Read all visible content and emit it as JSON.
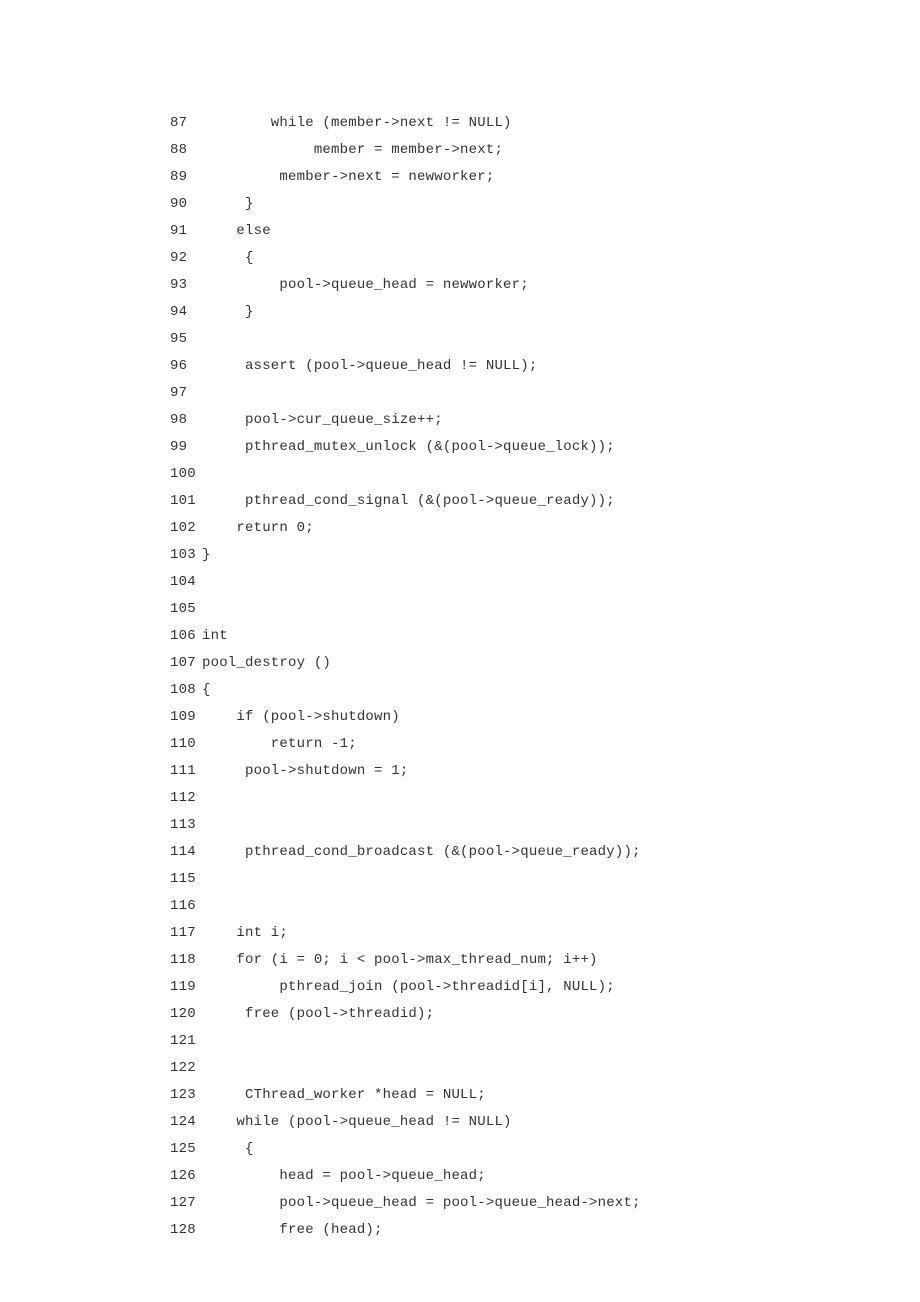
{
  "code_lines": [
    {
      "num": "87",
      "code": "        while (member->next != NULL)"
    },
    {
      "num": "88",
      "code": "             member = member->next;"
    },
    {
      "num": "89",
      "code": "         member->next = newworker;"
    },
    {
      "num": "90",
      "code": "     }"
    },
    {
      "num": "91",
      "code": "    else"
    },
    {
      "num": "92",
      "code": "     {"
    },
    {
      "num": "93",
      "code": "         pool->queue_head = newworker;"
    },
    {
      "num": "94",
      "code": "     }"
    },
    {
      "num": "95",
      "code": ""
    },
    {
      "num": "96",
      "code": "     assert (pool->queue_head != NULL);"
    },
    {
      "num": "97",
      "code": ""
    },
    {
      "num": "98",
      "code": "     pool->cur_queue_size++;"
    },
    {
      "num": "99",
      "code": "     pthread_mutex_unlock (&(pool->queue_lock));"
    },
    {
      "num": "100",
      "code": ""
    },
    {
      "num": "101",
      "code": "     pthread_cond_signal (&(pool->queue_ready));"
    },
    {
      "num": "102",
      "code": "    return 0;"
    },
    {
      "num": "103",
      "code": "}"
    },
    {
      "num": "104",
      "code": ""
    },
    {
      "num": "105",
      "code": ""
    },
    {
      "num": "106",
      "code": "int"
    },
    {
      "num": "107",
      "code": "pool_destroy ()"
    },
    {
      "num": "108",
      "code": "{"
    },
    {
      "num": "109",
      "code": "    if (pool->shutdown)"
    },
    {
      "num": "110",
      "code": "        return -1;"
    },
    {
      "num": "111",
      "code": "     pool->shutdown = 1;"
    },
    {
      "num": "112",
      "code": ""
    },
    {
      "num": "113",
      "code": ""
    },
    {
      "num": "114",
      "code": "     pthread_cond_broadcast (&(pool->queue_ready));"
    },
    {
      "num": "115",
      "code": ""
    },
    {
      "num": "116",
      "code": ""
    },
    {
      "num": "117",
      "code": "    int i;"
    },
    {
      "num": "118",
      "code": "    for (i = 0; i < pool->max_thread_num; i++)"
    },
    {
      "num": "119",
      "code": "         pthread_join (pool->threadid[i], NULL);"
    },
    {
      "num": "120",
      "code": "     free (pool->threadid);"
    },
    {
      "num": "121",
      "code": ""
    },
    {
      "num": "122",
      "code": ""
    },
    {
      "num": "123",
      "code": "     CThread_worker *head = NULL;"
    },
    {
      "num": "124",
      "code": "    while (pool->queue_head != NULL)"
    },
    {
      "num": "125",
      "code": "     {"
    },
    {
      "num": "126",
      "code": "         head = pool->queue_head;"
    },
    {
      "num": "127",
      "code": "         pool->queue_head = pool->queue_head->next;"
    },
    {
      "num": "128",
      "code": "         free (head);"
    }
  ]
}
